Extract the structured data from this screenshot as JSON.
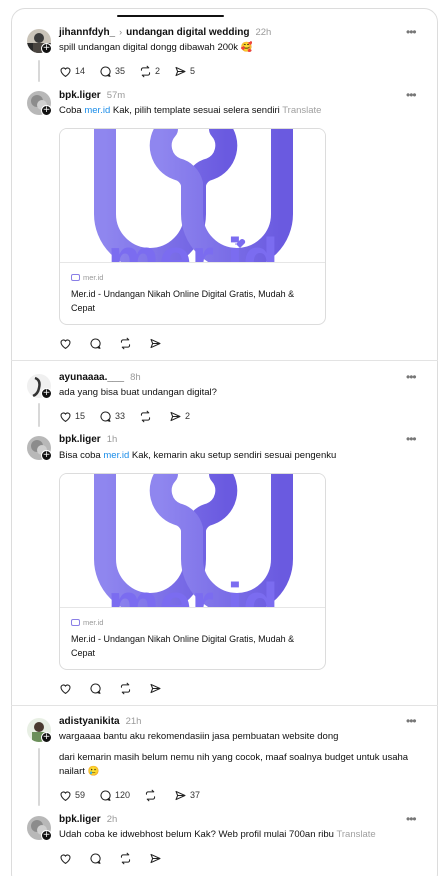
{
  "colors": {
    "accent_link": "#1a8ce8",
    "brand_purple": "#7b6cf0"
  },
  "posts": [
    {
      "username": "jihannfdyh_",
      "topic": "undangan digital wedding",
      "time": "22h",
      "text": "spill undangan digital dongg dibawah 200k 🥰",
      "likes": "14",
      "replies": "35",
      "reposts": "2",
      "shares": "5"
    },
    {
      "username": "bpk.liger",
      "time": "57m",
      "text_before": "Coba ",
      "link": "mer.id",
      "text_after": " Kak, pilih template sesuai selera sendiri",
      "translate": "Translate",
      "card": {
        "domain": "mer.id",
        "title": "Mer.id - Undangan Nikah Online Digital Gratis, Mudah & Cepat"
      }
    },
    {
      "username": "ayunaaaa.___",
      "time": "8h",
      "text": "ada yang bisa buat undangan digital?",
      "likes": "15",
      "replies": "33",
      "shares": "2"
    },
    {
      "username": "bpk.liger",
      "time": "1h",
      "text_before": "Bisa coba ",
      "link": "mer.id",
      "text_after": " Kak, kemarin aku setup sendiri sesuai pengenku",
      "card": {
        "domain": "mer.id",
        "title": "Mer.id - Undangan Nikah Online Digital Gratis, Mudah & Cepat"
      }
    },
    {
      "username": "adistyanikita",
      "time": "21h",
      "text1": "wargaaaa bantu aku rekomendasiin jasa pembuatan website dong",
      "text2": "dari kemarin masih belum nemu nih yang cocok, maaf soalnya budget untuk usaha nailart 🥲",
      "likes": "59",
      "replies": "120",
      "shares": "37"
    },
    {
      "username": "bpk.liger",
      "time": "2h",
      "text": "Udah coba ke idwebhost belum Kak? Web profil mulai 700an ribu",
      "translate": "Translate"
    }
  ],
  "icons": [
    "heart-icon",
    "comment-icon",
    "repost-icon",
    "share-icon",
    "more-icon",
    "follow-plus-icon",
    "chevron-right-icon"
  ]
}
